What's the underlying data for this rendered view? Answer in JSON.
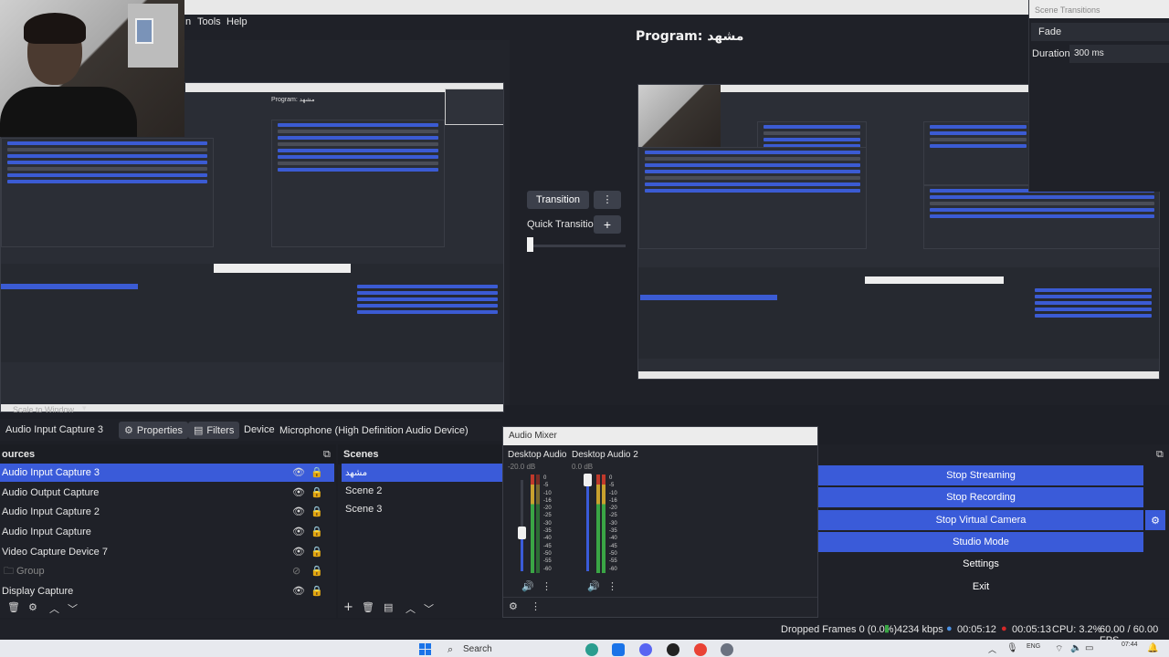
{
  "menu": {
    "tools": "Tools",
    "help": "Help"
  },
  "program_label": "Program: مشهد",
  "preview_inner_label": "Program: مشهد",
  "scene_transitions": {
    "title": "Scene Transitions",
    "selected": "Fade",
    "duration_label": "Duration",
    "duration_value": "300 ms"
  },
  "transition_panel": {
    "transition_button": "Transition",
    "quick_transitions": "Quick Transitions"
  },
  "source_toolbar": {
    "selected_source": "Audio Input Capture 3",
    "properties": "Properties",
    "filters": "Filters",
    "device_label": "Device",
    "device_value": "Microphone (High Definition Audio Device)"
  },
  "scale_label": "Scale to Window",
  "sources": {
    "title": "ources",
    "items": [
      {
        "label": "Audio Input Capture 3",
        "selected": true
      },
      {
        "label": "Audio Output Capture"
      },
      {
        "label": "Audio Input Capture 2"
      },
      {
        "label": "Audio Input Capture"
      },
      {
        "label": "Video Capture Device 7"
      },
      {
        "label": "Group"
      },
      {
        "label": "Display Capture"
      }
    ]
  },
  "scenes": {
    "title": "Scenes",
    "items": [
      {
        "label": "مشهد",
        "selected": true
      },
      {
        "label": "Scene 2"
      },
      {
        "label": "Scene 3"
      }
    ]
  },
  "audio_mixer": {
    "title": "Audio Mixer",
    "channels": [
      {
        "name": "Desktop Audio",
        "db": "-20.0 dB",
        "fader": 0.42
      },
      {
        "name": "Desktop Audio 2",
        "db": "0.0 dB",
        "fader": 1.0
      }
    ],
    "scale": [
      "0",
      "-5",
      "-10",
      "-16",
      "-20",
      "-25",
      "-30",
      "-35",
      "-40",
      "-45",
      "-50",
      "-55",
      "-60"
    ]
  },
  "controls": {
    "stop_streaming": "Stop Streaming",
    "stop_recording": "Stop Recording",
    "stop_virtual_camera": "Stop Virtual Camera",
    "studio_mode": "Studio Mode",
    "settings": "Settings",
    "exit": "Exit"
  },
  "status": {
    "dropped_frames": "Dropped Frames 0 (0.0%)",
    "bitrate": "4234 kbps",
    "stream_time": "00:05:12",
    "rec_time": "00:05:13",
    "cpu": "CPU: 3.2%",
    "fps": "60.00 / 60.00 FPS"
  },
  "taskbar": {
    "search": "Search",
    "lang": "ENG",
    "time": "07:44"
  },
  "colors": {
    "accent": "#3a5bd9",
    "background": "#1d1f26",
    "record": "#d62828"
  }
}
